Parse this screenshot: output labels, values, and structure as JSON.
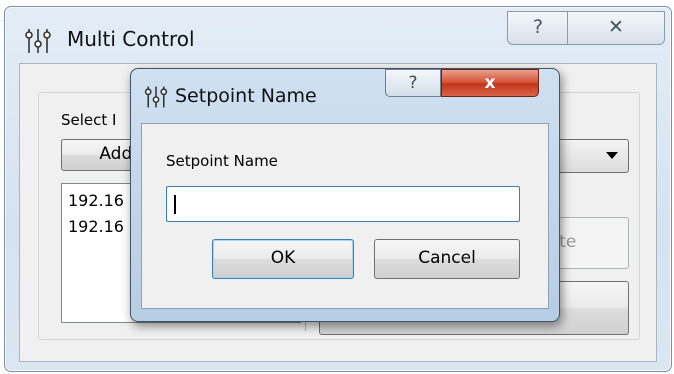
{
  "window": {
    "title": "Multi Control",
    "icon": "sliders-icon",
    "help_glyph": "?",
    "close_glyph": "✕"
  },
  "main": {
    "select_label": "Select I",
    "add_button": "Add I",
    "list_items": [
      "192.16",
      "192.16"
    ],
    "delete_button": "lete"
  },
  "dialog": {
    "title": "Setpoint Name",
    "icon": "sliders-icon",
    "help_glyph": "?",
    "close_glyph": "x",
    "field_label": "Setpoint Name",
    "field_value": "",
    "ok_button": "OK",
    "cancel_button": "Cancel"
  },
  "colors": {
    "frame": "#d5e2ef",
    "close_red": "#c4361b",
    "focus_blue": "#3c7fb1"
  }
}
